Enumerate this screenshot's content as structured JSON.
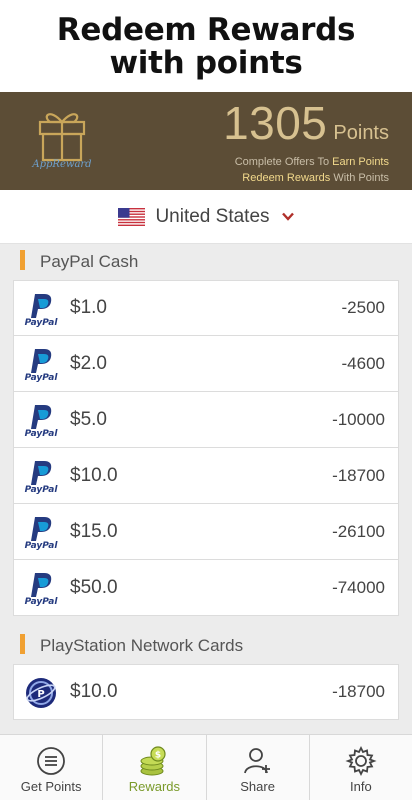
{
  "promo": {
    "line1": "Redeem Rewards",
    "line2": "with points"
  },
  "banner": {
    "logo_text": "AppReward",
    "points_value": "1305",
    "points_label": "Points",
    "line1_pre": "Complete Offers To ",
    "line1_hl": "Earn Points",
    "line2_hl": "Redeem Rewards",
    "line2_post": " With Points",
    "bg_color": "#5c4d36",
    "accent_color": "#d7c190"
  },
  "country": {
    "name": "United States",
    "flag_icon": "us-flag-icon",
    "caret_icon": "chevron-down-icon"
  },
  "sections": [
    {
      "title": "PayPal Cash",
      "icon": "paypal-icon",
      "items": [
        {
          "amount": "$1.0",
          "cost": "-2500"
        },
        {
          "amount": "$2.0",
          "cost": "-4600"
        },
        {
          "amount": "$5.0",
          "cost": "-10000"
        },
        {
          "amount": "$10.0",
          "cost": "-18700"
        },
        {
          "amount": "$15.0",
          "cost": "-26100"
        },
        {
          "amount": "$50.0",
          "cost": "-74000"
        }
      ]
    },
    {
      "title": "PlayStation Network Cards",
      "icon": "playstation-network-icon",
      "items": [
        {
          "amount": "$10.0",
          "cost": "-18700"
        }
      ]
    }
  ],
  "tabs": [
    {
      "label": "Get Points",
      "icon": "list-icon",
      "active": false
    },
    {
      "label": "Rewards",
      "icon": "coins-icon",
      "active": true
    },
    {
      "label": "Share",
      "icon": "add-user-icon",
      "active": false
    },
    {
      "label": "Info",
      "icon": "gear-icon",
      "active": false
    }
  ],
  "colors": {
    "section_bar": "#f0a032",
    "active_tab": "#7a9a2a",
    "list_bg": "#ececec"
  }
}
